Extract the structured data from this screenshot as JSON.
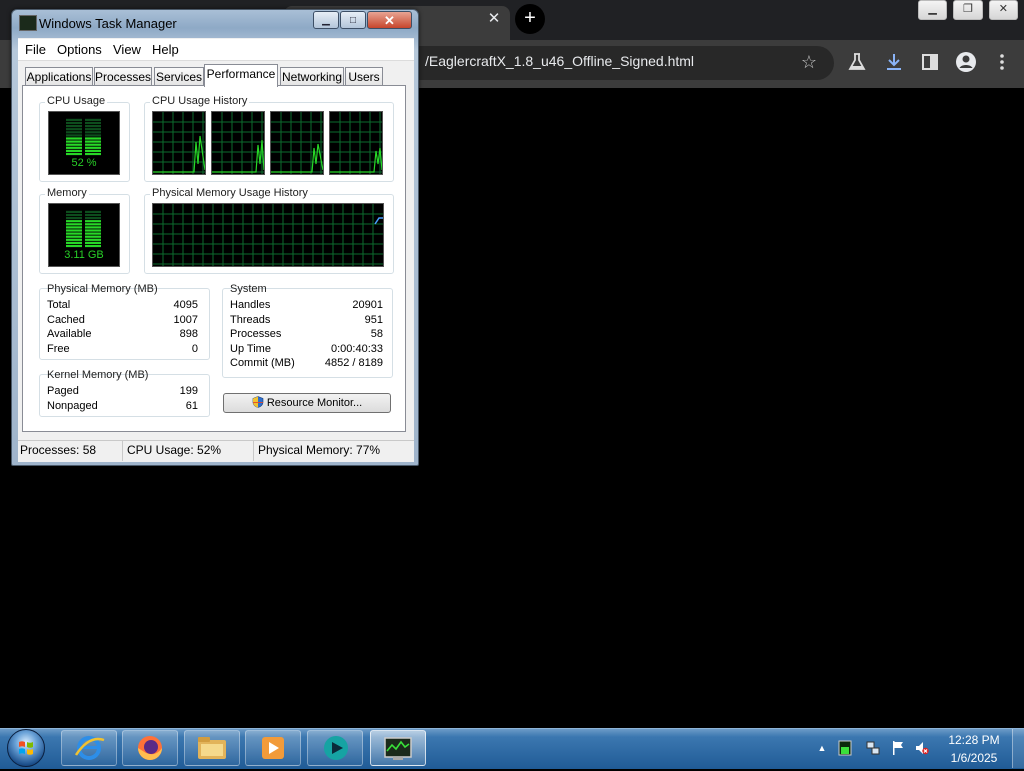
{
  "browser": {
    "url": "/EaglercraftX_1.8_u46_Offline_Signed.html",
    "tab_close": "✕",
    "new_tab": "+",
    "window_controls": {
      "minimize": "▁",
      "restore": "❐",
      "close": "✕"
    },
    "toolbar_icons": [
      "star-icon",
      "labs-flask-icon",
      "download-icon",
      "side-panel-icon",
      "profile-icon",
      "menu-kebab-icon"
    ]
  },
  "taskmanager": {
    "title": "Windows Task Manager",
    "title_buttons": {
      "minimize": "▁",
      "maximize": "□",
      "close": "✕"
    },
    "menu": [
      "File",
      "Options",
      "View",
      "Help"
    ],
    "tabs": [
      "Applications",
      "Processes",
      "Services",
      "Performance",
      "Networking",
      "Users"
    ],
    "active_tab": "Performance",
    "cpu": {
      "label": "CPU Usage",
      "value": "52 %",
      "level": 0.52
    },
    "cpu_history": {
      "label": "CPU Usage History",
      "cores": 4
    },
    "memory": {
      "label": "Memory",
      "value": "3.11 GB",
      "level": 0.77
    },
    "memory_history": {
      "label": "Physical Memory Usage History"
    },
    "physical_memory": {
      "title": "Physical Memory (MB)",
      "rows": [
        {
          "label": "Total",
          "value": "4095"
        },
        {
          "label": "Cached",
          "value": "1007"
        },
        {
          "label": "Available",
          "value": "898"
        },
        {
          "label": "Free",
          "value": "0"
        }
      ]
    },
    "kernel_memory": {
      "title": "Kernel Memory (MB)",
      "rows": [
        {
          "label": "Paged",
          "value": "199"
        },
        {
          "label": "Nonpaged",
          "value": "61"
        }
      ]
    },
    "system": {
      "title": "System",
      "rows": [
        {
          "label": "Handles",
          "value": "20901"
        },
        {
          "label": "Threads",
          "value": "951"
        },
        {
          "label": "Processes",
          "value": "58"
        },
        {
          "label": "Up Time",
          "value": "0:00:40:33"
        },
        {
          "label": "Commit (MB)",
          "value": "4852 / 8189"
        }
      ]
    },
    "resource_monitor_button": "Resource Monitor...",
    "status": {
      "processes": "Processes: 58",
      "cpu": "CPU Usage: 52%",
      "memory": "Physical Memory: 77%"
    }
  },
  "taskbar": {
    "pinned": [
      "internet-explorer-icon",
      "firefox-icon",
      "file-explorer-icon",
      "media-player-icon",
      "app-icon",
      "task-manager-icon"
    ],
    "tray_icons": [
      "show-hidden-icons-icon",
      "cpu-meter-icon",
      "network-icon",
      "action-center-flag-icon",
      "volume-muted-icon"
    ],
    "time": "12:28 PM",
    "date": "1/6/2025"
  },
  "colors": {
    "graph_green": "#27d827",
    "graph_grid": "#0d6b2e",
    "memory_line": "#4aa0ff",
    "taskbar_blue": "#205b96"
  }
}
